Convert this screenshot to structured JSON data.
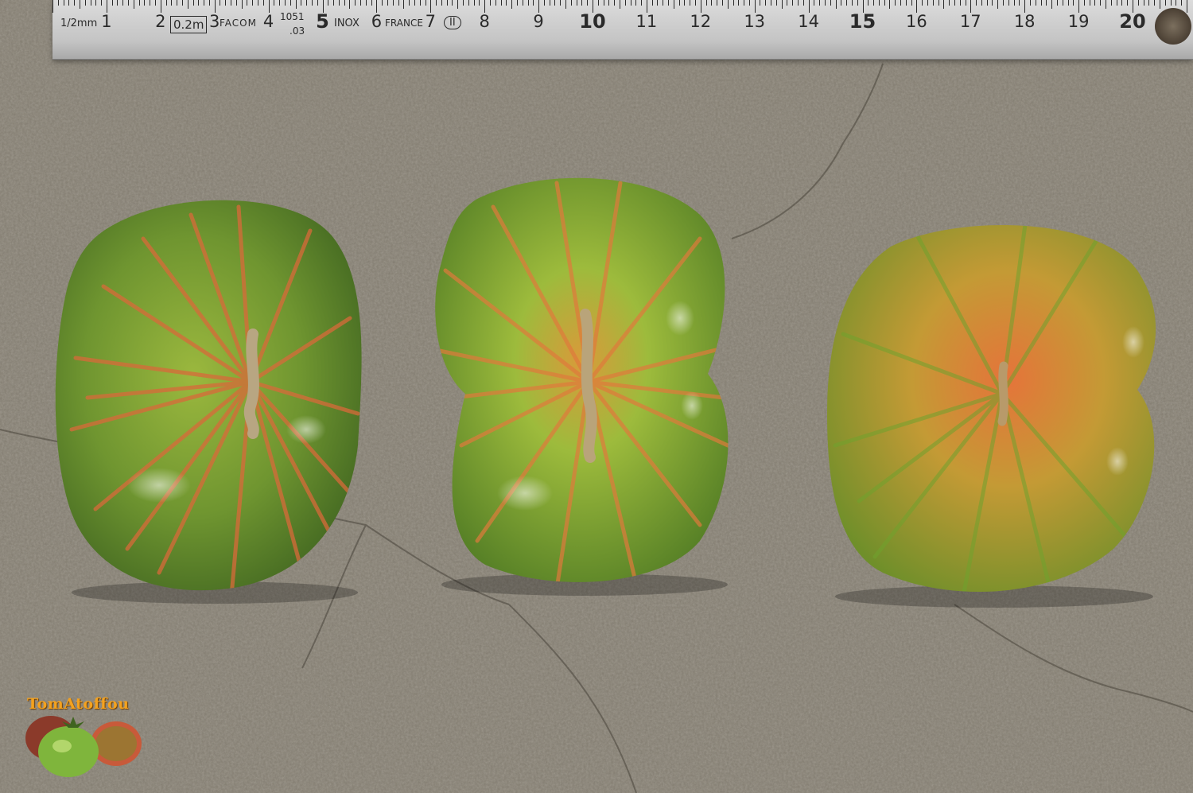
{
  "ruler": {
    "unit_label": "1/2mm",
    "spec_box": "0.2m",
    "brand": "FACOM",
    "model_top": "1051",
    "model_bottom": ".03",
    "material": "INOX",
    "country": "FRANCE",
    "class_mark": "II",
    "numbers": [
      "1",
      "2",
      "3",
      "4",
      "5",
      "6",
      "7",
      "8",
      "9",
      "10",
      "11",
      "12",
      "13",
      "14",
      "15",
      "16",
      "17",
      "18",
      "19",
      "20"
    ],
    "bold_numbers": [
      "5",
      "10",
      "15",
      "20"
    ]
  },
  "subject": {
    "tomatoes": [
      {
        "name": "tomato-left",
        "base_color": "#5f8a2a",
        "stripe_color": "#d96a35"
      },
      {
        "name": "tomato-middle",
        "base_color": "#78a233",
        "stripe_color": "#df7a3a"
      },
      {
        "name": "tomato-right",
        "base_color": "#8a9a2c",
        "stripe_color": "#e0823a"
      }
    ],
    "surface_color": "#857f72"
  },
  "watermark": {
    "text": "TomAtoffou"
  }
}
